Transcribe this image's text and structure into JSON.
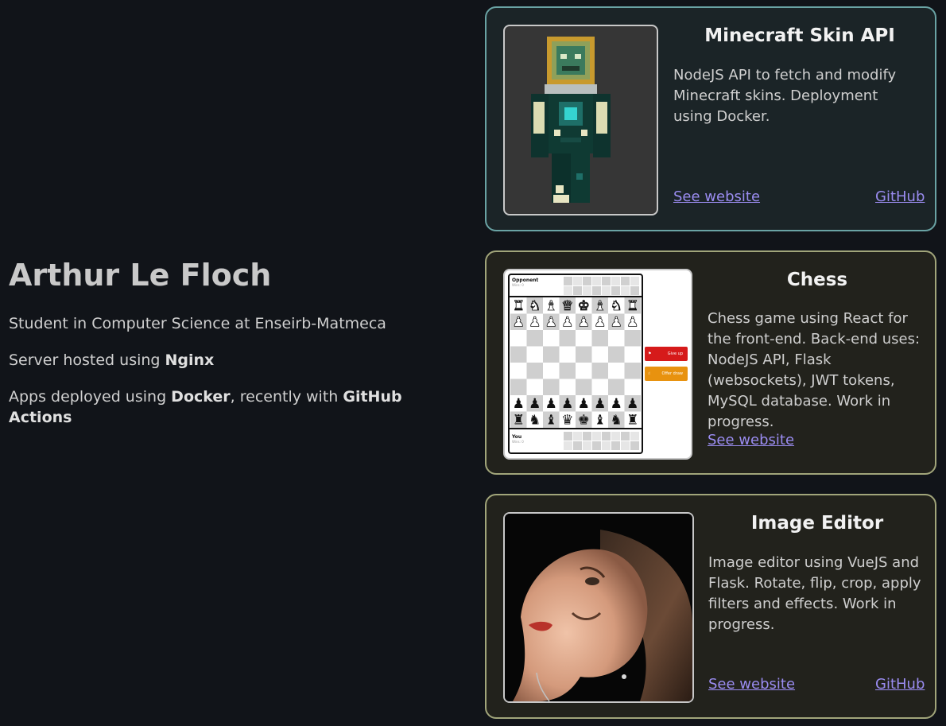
{
  "intro": {
    "name": "Arthur Le Floch",
    "line1": "Student in Computer Science at Enseirb-Matmeca",
    "line2_prefix": "Server hosted using ",
    "line2_bold": "Nginx",
    "line3_prefix": "Apps deployed using ",
    "line3_bold1": "Docker",
    "line3_mid": ", recently with ",
    "line3_bold2": "GitHub Actions"
  },
  "projects": [
    {
      "title": "Minecraft Skin API",
      "description": "NodeJS API to fetch and modify Minecraft skins. Deployment using Docker.",
      "website_label": "See website",
      "github_label": "GitHub"
    },
    {
      "title": "Chess",
      "description": "Chess game using React for the front-end. Back-end uses: NodeJS API, Flask (websockets), JWT tokens, MySQL database. Work in progress.",
      "website_label": "See website",
      "thumb": {
        "opponent_label": "Opponent",
        "opponent_wins": "Wins: 0",
        "you_label": "You",
        "you_wins": "Wins: 0",
        "give_up": "Give up",
        "offer_draw": "Offer draw"
      }
    },
    {
      "title": "Image Editor",
      "description": "Image editor using VueJS and Flask. Rotate, flip, crop, apply filters and effects. Work in progress.",
      "website_label": "See website",
      "github_label": "GitHub"
    }
  ],
  "colors": {
    "background": "#111419",
    "card_teal_border": "#6aa3a4",
    "card_olive_border": "#a1a57a",
    "link": "#9a8cf0",
    "chess_red_button": "#d61a1a",
    "chess_orange_button": "#e8920f"
  },
  "icons": {
    "give_up": "flag-icon",
    "offer_draw": "handshake-icon"
  }
}
